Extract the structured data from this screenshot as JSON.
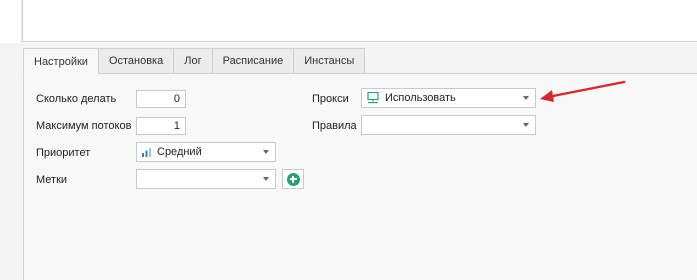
{
  "tabs": [
    {
      "label": "Настройки",
      "active": true
    },
    {
      "label": "Остановка",
      "active": false
    },
    {
      "label": "Лог",
      "active": false
    },
    {
      "label": "Расписание",
      "active": false
    },
    {
      "label": "Инстансы",
      "active": false
    }
  ],
  "settings": {
    "how_many_label": "Сколько делать",
    "how_many_value": "0",
    "max_threads_label": "Максимум потоков",
    "max_threads_value": "1",
    "priority_label": "Приоритет",
    "priority_value": "Средний",
    "tags_label": "Метки",
    "tags_value": "",
    "proxy_label": "Прокси",
    "proxy_value": "Использовать",
    "rules_label": "Правила",
    "rules_value": ""
  },
  "colors": {
    "accent_green": "#27a372",
    "arrow_red": "#d9262a",
    "priority_icon_blue": "#3a82c8"
  },
  "icons": {
    "priority": "bar-chart-icon",
    "proxy": "monitor-network-icon",
    "add": "plus-circle-icon",
    "annotation": "red-arrow-icon"
  }
}
